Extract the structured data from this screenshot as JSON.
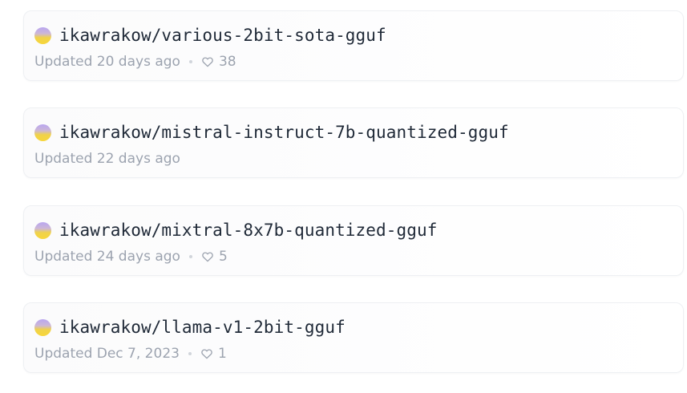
{
  "models": [
    {
      "name": "ikawrakow/various-2bit-sota-gguf",
      "updated": "Updated 20 days ago",
      "likes": "38",
      "show_likes": true
    },
    {
      "name": "ikawrakow/mistral-instruct-7b-quantized-gguf",
      "updated": "Updated 22 days ago",
      "likes": "",
      "show_likes": false
    },
    {
      "name": "ikawrakow/mixtral-8x7b-quantized-gguf",
      "updated": "Updated 24 days ago",
      "likes": "5",
      "show_likes": true
    },
    {
      "name": "ikawrakow/llama-v1-2bit-gguf",
      "updated": "Updated Dec 7, 2023",
      "likes": "1",
      "show_likes": true
    }
  ],
  "icons": {
    "avatar": "user-avatar",
    "like": "heart-icon"
  },
  "colors": {
    "avatar_top": "#b9a6f0",
    "avatar_bottom": "#f7d63a",
    "title": "#1f2937",
    "meta": "#9ca3af"
  }
}
